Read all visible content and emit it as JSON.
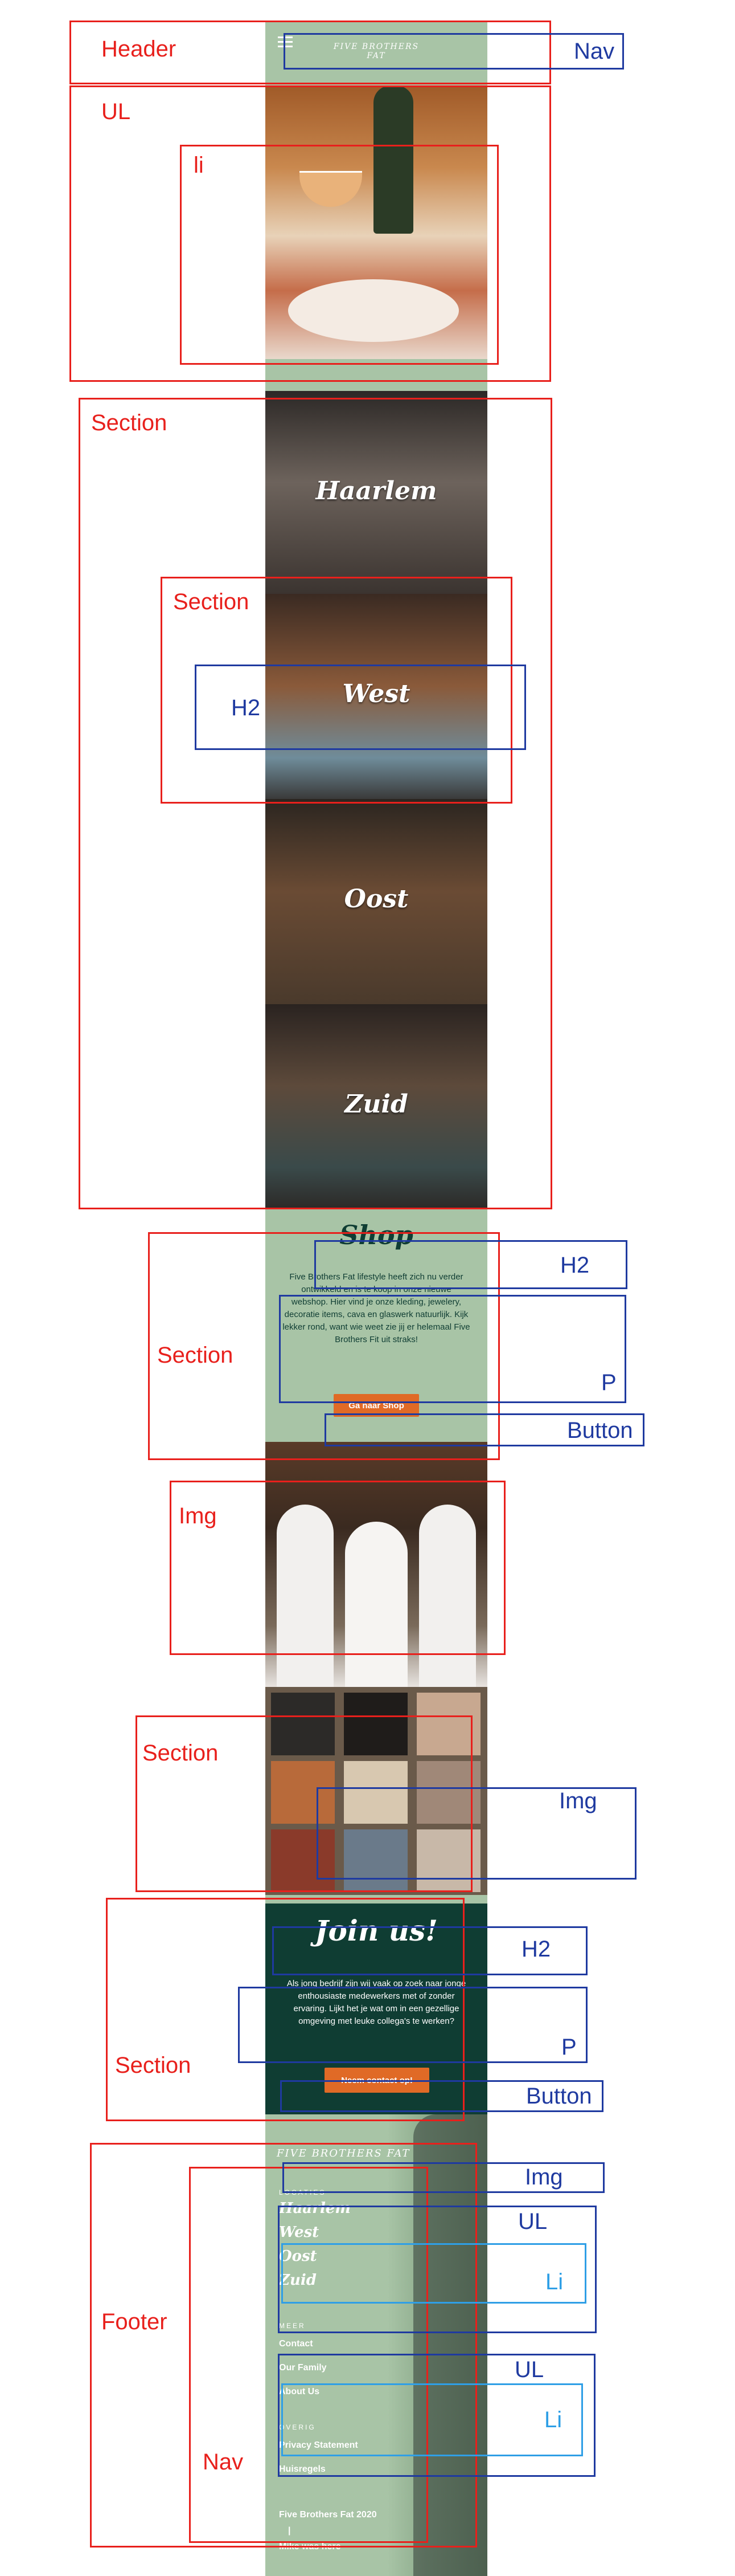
{
  "header": {
    "logo_text": "FIVE BROTHERS FAT",
    "menu_icon": "hamburger-icon"
  },
  "locations": [
    "Haarlem",
    "West",
    "Oost",
    "Zuid"
  ],
  "shop": {
    "title": "Shop",
    "body": "Five Brothers Fat lifestyle heeft zich nu verder ontwikkeld en is te koop in onze nieuwe webshop. Hier vind je onze kleding, jewelery, decoratie items, cava en glaswerk natuurlijk. Kijk lekker rond, want wie weet zie jij er helemaal Five Brothers Fit uit straks!",
    "button": "Ga naar Shop"
  },
  "join": {
    "title": "Join us!",
    "body": "Als jong bedrijf zijn wij vaak op zoek naar jonge enthousiaste medewerkers met of zonder ervaring. Lijkt het je wat om in een gezellige omgeving met leuke collega's te werken?",
    "button": "Neem contact op!"
  },
  "footer": {
    "logo_text": "FIVE BROTHERS FAT",
    "locaties_heading": "LOCATIES",
    "locaties": [
      "Haarlem",
      "West",
      "Oost",
      "Zuid"
    ],
    "meer_heading": "MEER",
    "meer": [
      "Contact",
      "Our Family",
      "About Us"
    ],
    "overig_heading": "OVERIG",
    "overig": [
      "Privacy Statement",
      "Huisregels"
    ],
    "copyright": "Five Brothers Fat 2020",
    "divider": "|",
    "credit": "Mike was here"
  },
  "annotations": {
    "header": "Header",
    "nav": "Nav",
    "ul": "UL",
    "li": "li",
    "section": "Section",
    "h2": "H2",
    "p": "P",
    "button": "Button",
    "img": "Img",
    "footer": "Footer",
    "li_cap": "Li"
  },
  "colors": {
    "red": "#e8201c",
    "blue": "#1f3aa0",
    "light_blue": "#2f9fe6",
    "sage": "#a8c4a6",
    "dark_green": "#0f3d33",
    "orange": "#e06a26"
  }
}
